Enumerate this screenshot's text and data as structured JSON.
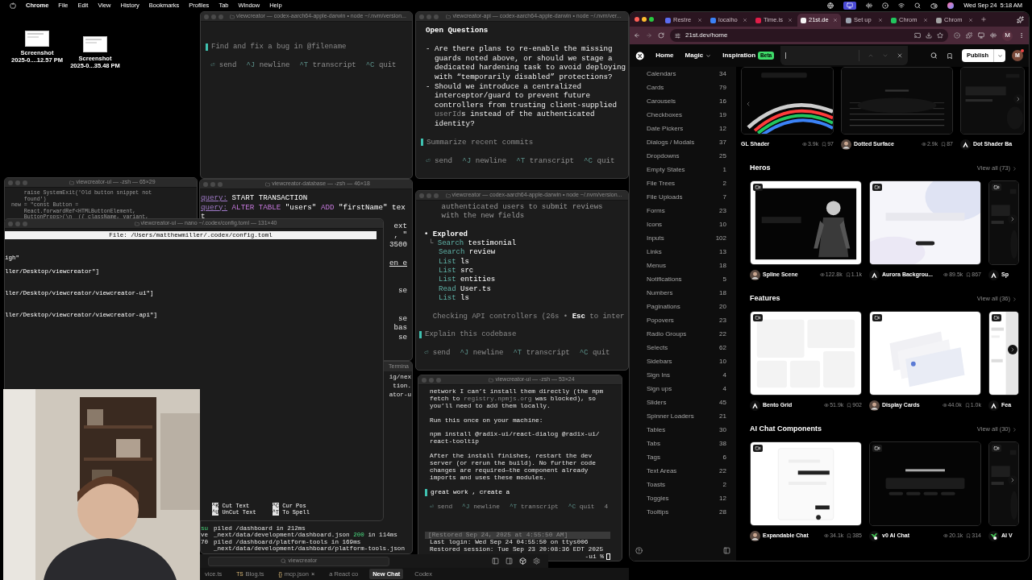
{
  "menu_bar": {
    "app": "Chrome",
    "items": [
      "File",
      "Edit",
      "View",
      "History",
      "Bookmarks",
      "Profiles",
      "Tab",
      "Window",
      "Help"
    ],
    "clock": "Wed Sep 24  5:18 AM"
  },
  "desktop_icons": [
    {
      "line1": "Screenshot",
      "line2": "2025-0....12.57 PM"
    },
    {
      "line1": "Screenshot",
      "line2": "2025-0...35.48 PM"
    }
  ],
  "terminals": [
    {
      "title": "viewcreator — codex-aarch64-apple-darwin • node ~/.nvm/version...",
      "lines": [
        {
          "kind": "prompt",
          "text": "Find and fix a bug in @filename",
          "placeholder": true
        },
        {
          "kind": "blank"
        },
        {
          "kind": "hint",
          "items": [
            {
              "key": "⏎",
              "label": "send"
            },
            {
              "key": "^J",
              "label": "newline"
            },
            {
              "key": "^T",
              "label": "transcript"
            },
            {
              "key": "^C",
              "label": "quit"
            }
          ]
        }
      ]
    },
    {
      "title": "viewcreator-api — codex-aarch64-apple-darwin • node ~/.nvm/ver...",
      "lines": [
        {
          "kind": "heading",
          "text": "Open Questions"
        },
        {
          "kind": "blank"
        },
        {
          "kind": "text",
          "text": "- Are there plans to re-enable the missing"
        },
        {
          "kind": "text",
          "text": "  guards noted above, or should we stage a"
        },
        {
          "kind": "text",
          "text": "  dedicated hardening task to avoid deploying"
        },
        {
          "kind": "text",
          "text": "  with “temporarily disabled” protections?"
        },
        {
          "kind": "text",
          "text": "- Should we introduce a centralized"
        },
        {
          "kind": "text",
          "text": "  interceptor/guard to prevent future"
        },
        {
          "kind": "text",
          "text": "  controllers from trusting client-supplied"
        },
        {
          "kind": "mixed",
          "parts": [
            {
              "text": "  userId",
              "kind": "dim"
            },
            {
              "text": "s instead of the authenticated",
              "kind": "plain"
            }
          ]
        },
        {
          "kind": "text",
          "text": "  identity?"
        },
        {
          "kind": "blank"
        },
        {
          "kind": "prompt",
          "text": "Summarize recent commits",
          "placeholder": true
        },
        {
          "kind": "blank"
        },
        {
          "kind": "hint",
          "items": [
            {
              "key": "⏎",
              "label": "send"
            },
            {
              "key": "^J",
              "label": "newline"
            },
            {
              "key": "^T",
              "label": "transcript"
            },
            {
              "key": "^C",
              "label": "quit"
            }
          ]
        }
      ]
    },
    {
      "title": "viewcreator-ui — -zsh — 65×29",
      "lines": [
        {
          "kind": "text",
          "text": "    raise SystemExit('Old button snippet not"
        },
        {
          "kind": "text",
          "text": "    found')"
        },
        {
          "kind": "text",
          "text": "new = \"const Button ="
        },
        {
          "kind": "text",
          "text": "    React.forwardRef<HTMLButtonElement,"
        },
        {
          "kind": "text",
          "text": "    ButtonProps>(\\n  ({ className, variant,"
        }
      ]
    },
    {
      "title": "viewcreator-database — -zsh — 46×18",
      "lines": [
        {
          "kind": "query",
          "label": "query:",
          "parts": [
            {
              "text": "START TRANSACTION",
              "kind": "plain"
            }
          ]
        },
        {
          "kind": "query",
          "label": "query:",
          "parts": [
            {
              "text": "ALTER TABLE",
              "kind": "accent"
            },
            {
              "text": " \"users\" ",
              "kind": "plain"
            },
            {
              "text": "ADD",
              "kind": "accent"
            },
            {
              "text": " \"firstName\" tex",
              "kind": "plain"
            }
          ]
        },
        {
          "kind": "text",
          "text": "t"
        },
        {
          "kind": "fragment",
          "text": "ext",
          "underline": false
        },
        {
          "kind": "fragment",
          "text": ", \"",
          "underline": false
        },
        {
          "kind": "fragment",
          "text": "3500",
          "underline": false
        },
        {
          "kind": "blank"
        },
        {
          "kind": "fragment",
          "text": "en e",
          "underline": true
        },
        {
          "kind": "blank"
        },
        {
          "kind": "blank"
        },
        {
          "kind": "fragment",
          "text": "se",
          "underline": false
        },
        {
          "kind": "blank"
        },
        {
          "kind": "blank"
        },
        {
          "kind": "fragment",
          "text": "se",
          "underline": false
        },
        {
          "kind": "fragment",
          "text": "bas",
          "underline": false
        },
        {
          "kind": "fragment",
          "text": "se",
          "underline": false
        }
      ]
    },
    {
      "title": "viewcreator — codex-aarch64-apple-darwin • node ~/.nvm/version...",
      "lines": [
        {
          "kind": "dim",
          "text": "    authenticated users to submit reviews"
        },
        {
          "kind": "dim",
          "text": "    with the new fields"
        },
        {
          "kind": "blank"
        },
        {
          "kind": "bullet",
          "marker": "•",
          "text": "Explored"
        },
        {
          "kind": "action",
          "branch": "└",
          "verb": "Search",
          "arg": "testimonial"
        },
        {
          "kind": "action",
          "verb": "Search",
          "arg": "review"
        },
        {
          "kind": "action",
          "verb": "List",
          "arg": "ls"
        },
        {
          "kind": "action",
          "verb": "List",
          "arg": "src"
        },
        {
          "kind": "action",
          "verb": "List",
          "arg": "entities"
        },
        {
          "kind": "action",
          "verb": "Read",
          "arg": "User.ts"
        },
        {
          "kind": "action",
          "verb": "List",
          "arg": "ls"
        },
        {
          "kind": "blank"
        },
        {
          "kind": "mixed",
          "parts": [
            {
              "text": "  Checking API controllers (26s • ",
              "kind": "dim"
            },
            {
              "text": "Esc",
              "kind": "bold"
            },
            {
              "text": " to inter",
              "kind": "dim"
            }
          ]
        },
        {
          "kind": "blank"
        },
        {
          "kind": "prompt",
          "text": "Explain this codebase",
          "placeholder": true
        },
        {
          "kind": "blank"
        },
        {
          "kind": "hint",
          "items": [
            {
              "key": "⏎",
              "label": "send"
            },
            {
              "key": "^J",
              "label": "newline"
            },
            {
              "key": "^T",
              "label": "transcript"
            },
            {
              "key": "^C",
              "label": "quit"
            }
          ]
        }
      ]
    },
    {
      "title": "viewcreator-ui — -zsh — 53×24",
      "lines": [
        {
          "kind": "text",
          "text": "network I can’t install them directly (the npm"
        },
        {
          "kind": "mixed",
          "parts": [
            {
              "text": "fetch to ",
              "kind": "plain"
            },
            {
              "text": "registry.npmjs.org",
              "kind": "dim"
            },
            {
              "text": " was blocked), so",
              "kind": "plain"
            }
          ]
        },
        {
          "kind": "text",
          "text": "you’ll need to add them locally."
        },
        {
          "kind": "blank"
        },
        {
          "kind": "text",
          "text": "Run this once on your machine:"
        },
        {
          "kind": "blank"
        },
        {
          "kind": "text",
          "text": "npm install @radix-ui/react-dialog @radix-ui/"
        },
        {
          "kind": "text",
          "text": "react-tooltip"
        },
        {
          "kind": "blank"
        },
        {
          "kind": "text",
          "text": "After the install finishes, restart the dev"
        },
        {
          "kind": "text",
          "text": "server (or rerun the build). No further code"
        },
        {
          "kind": "text",
          "text": "changes are required—the component already"
        },
        {
          "kind": "text",
          "text": "imports and uses these modules."
        },
        {
          "kind": "blank"
        },
        {
          "kind": "prompt",
          "text": "great work , create a",
          "placeholder": false
        },
        {
          "kind": "blank"
        },
        {
          "kind": "hint",
          "extra": "4",
          "items": [
            {
              "key": "⏎",
              "label": "send"
            },
            {
              "key": "^J",
              "label": "newline"
            },
            {
              "key": "^T",
              "label": "transcript"
            },
            {
              "key": "^C",
              "label": "quit"
            }
          ]
        },
        {
          "kind": "blank"
        },
        {
          "kind": "blank"
        },
        {
          "kind": "blank"
        },
        {
          "kind": "restored",
          "text": "[Restored Sep 24, 2025 at 4:55:50 AM]"
        },
        {
          "kind": "text",
          "text": "Last login: Wed Sep 24 04:55:50 on ttys006"
        },
        {
          "kind": "text",
          "text": "Restored session: Tue Sep 23 20:08:36 EDT 2025"
        },
        {
          "kind": "shell",
          "text": "-ui %",
          "cursor": true
        }
      ]
    }
  ],
  "nano": {
    "title": "viewcreator-ui — nano ~/.codex/config.toml — 131×40",
    "header": "File: /Users/matthewmiller/.codex/config.toml",
    "lines": [
      "igh\"",
      "ller/Desktop/viewcreator\"]",
      "ller/Desktop/viewcreator/viewcreator-ui\"]",
      "ller/Desktop/viewcreator/viewcreator-api\"]"
    ],
    "shortcuts": [
      {
        "key": "^K",
        "label": "Cut Text"
      },
      {
        "key": "^U",
        "label": "UnCut Text"
      },
      {
        "key": "^C",
        "label": "Cur Pos"
      },
      {
        "key": "^T",
        "label": "To Spell"
      }
    ]
  },
  "log_window": {
    "title": "Termina",
    "fragments": [
      "ig/nex",
      "tion.",
      "ator-u"
    ],
    "rows": [
      {
        "gutter": {
          "text": "su",
          "kind": "green"
        },
        "parts": [
          {
            "text": "piled /dashboard in 212ms",
            "kind": "plain"
          }
        ]
      },
      {
        "gutter": {
          "text": "ve",
          "kind": "plain"
        },
        "parts": [
          {
            "text": "_next/data/development/dashboard.json ",
            "kind": "plain"
          },
          {
            "text": "200",
            "kind": "green"
          },
          {
            "text": " in 114ms",
            "kind": "plain"
          }
        ]
      },
      {
        "gutter": {
          "text": "70",
          "kind": "plain"
        },
        "parts": [
          {
            "text": "piled /dashboard/platform-tools in 169ms",
            "kind": "plain"
          }
        ]
      },
      {
        "parts": [
          {
            "text": "_next/data/development/dashboard/platform-tools.json",
            "kind": "plain"
          }
        ]
      }
    ]
  },
  "editor": {
    "search": "viewcreator",
    "tabs": [
      {
        "label": "vice.ts",
        "selected": false
      },
      {
        "label": "Blog.ts",
        "badge": "TS",
        "selected": false
      },
      {
        "label": "mcp.json",
        "badge": "{}",
        "close": "×",
        "selected": false
      },
      {
        "label": "a React co",
        "selected": false
      },
      {
        "label": "New Chat",
        "selected": true
      },
      {
        "label": "Codex",
        "selected": false
      }
    ]
  },
  "browser": {
    "tabs": [
      {
        "label": "Restre",
        "selected": false,
        "color": "#5b6cf0"
      },
      {
        "label": "localho",
        "selected": false,
        "color": "#3b82f6"
      },
      {
        "label": "Time.is",
        "selected": false,
        "color": "#e11d48"
      },
      {
        "label": "21st.de",
        "selected": true,
        "color": "#f5f5f5"
      },
      {
        "label": "Set up",
        "selected": false,
        "color": "#9ca3af"
      },
      {
        "label": "Chrom",
        "selected": false,
        "color": "#22c55e"
      },
      {
        "label": "Chrom",
        "selected": false,
        "color": "#a3a3a3"
      }
    ],
    "url": "21st.dev/home",
    "profile": "M",
    "nav": [
      {
        "label": "Home",
        "dropdown": false
      },
      {
        "label": "Magic",
        "dropdown": true
      },
      {
        "label": "Inspiration",
        "dropdown": false,
        "badge": "Beta"
      }
    ],
    "publish": "Publish",
    "avatar": "M",
    "categories": [
      {
        "label": "Calendars",
        "count": "34"
      },
      {
        "label": "Cards",
        "count": "79"
      },
      {
        "label": "Carousels",
        "count": "16"
      },
      {
        "label": "Checkboxes",
        "count": "19"
      },
      {
        "label": "Date Pickers",
        "count": "12"
      },
      {
        "label": "Dialogs / Modals",
        "count": "37"
      },
      {
        "label": "Dropdowns",
        "count": "25"
      },
      {
        "label": "Empty States",
        "count": "1"
      },
      {
        "label": "File Trees",
        "count": "2"
      },
      {
        "label": "File Uploads",
        "count": "7"
      },
      {
        "label": "Forms",
        "count": "23"
      },
      {
        "label": "Icons",
        "count": "10"
      },
      {
        "label": "Inputs",
        "count": "102"
      },
      {
        "label": "Links",
        "count": "13"
      },
      {
        "label": "Menus",
        "count": "18"
      },
      {
        "label": "Notifications",
        "count": "5"
      },
      {
        "label": "Numbers",
        "count": "18"
      },
      {
        "label": "Paginations",
        "count": "20"
      },
      {
        "label": "Popovers",
        "count": "23"
      },
      {
        "label": "Radio Groups",
        "count": "22"
      },
      {
        "label": "Selects",
        "count": "62"
      },
      {
        "label": "Sidebars",
        "count": "10"
      },
      {
        "label": "Sign Ins",
        "count": "4"
      },
      {
        "label": "Sign ups",
        "count": "4"
      },
      {
        "label": "Sliders",
        "count": "45"
      },
      {
        "label": "Spinner Loaders",
        "count": "21"
      },
      {
        "label": "Tables",
        "count": "30"
      },
      {
        "label": "Tabs",
        "count": "38"
      },
      {
        "label": "Tags",
        "count": "6"
      },
      {
        "label": "Text Areas",
        "count": "22"
      },
      {
        "label": "Toasts",
        "count": "2"
      },
      {
        "label": "Toggles",
        "count": "12"
      },
      {
        "label": "Tooltips",
        "count": "28"
      }
    ],
    "top_row": [
      {
        "name": "GL Shader",
        "kind": "none",
        "views": "3.9k",
        "saves": "97"
      },
      {
        "name": "Dotted Surface",
        "kind": "person",
        "views": "2.9k",
        "saves": "87"
      },
      {
        "name": "Dot Shader Ba",
        "kind": "mark"
      }
    ],
    "sections": [
      {
        "title": "Heros",
        "view_all": "View all (73)",
        "cards": [
          {
            "name": "Spline Scene",
            "kind": "person",
            "views": "122.8k",
            "saves": "1.1k"
          },
          {
            "name": "Aurora Backgrou...",
            "kind": "mark",
            "views": "89.5k",
            "saves": "867"
          },
          {
            "name": "Sp",
            "kind": "mark"
          }
        ]
      },
      {
        "title": "Features",
        "view_all": "View all (36)",
        "cards": [
          {
            "name": "Bento Grid",
            "kind": "mark",
            "views": "51.9k",
            "saves": "902"
          },
          {
            "name": "Display Cards",
            "kind": "person",
            "views": "44.0k",
            "saves": "1.0k"
          },
          {
            "name": "Fea",
            "kind": "mark"
          }
        ]
      },
      {
        "title": "AI Chat Components",
        "view_all": "View all (30)",
        "cards": [
          {
            "name": "Expandable Chat",
            "kind": "person",
            "views": "34.1k",
            "saves": "385"
          },
          {
            "name": "v0 AI Chat",
            "kind": "leaf",
            "views": "20.1k",
            "saves": "314"
          },
          {
            "name": "AI V",
            "kind": "leaf"
          }
        ]
      }
    ]
  }
}
